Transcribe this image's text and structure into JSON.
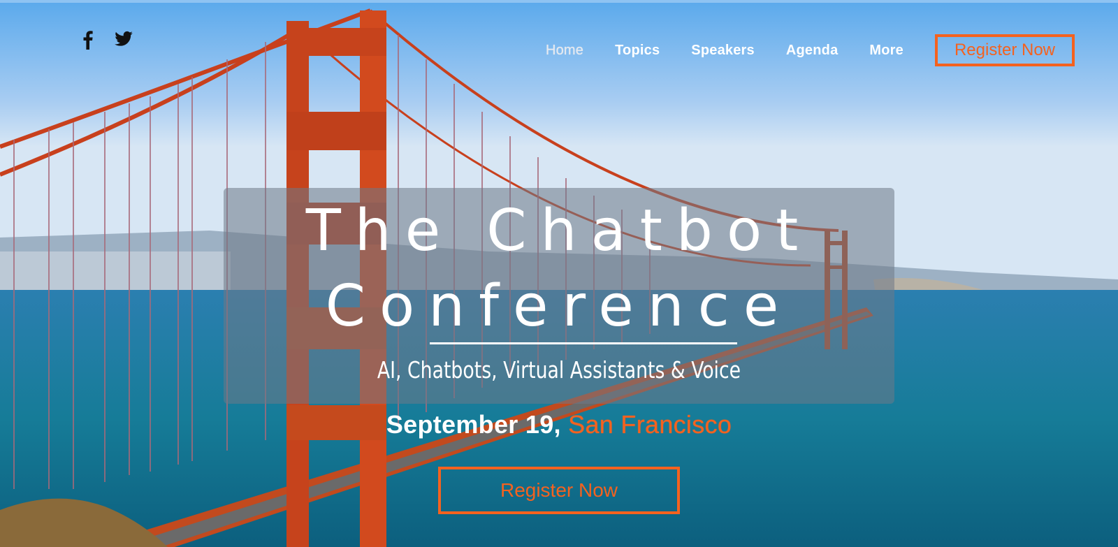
{
  "colors": {
    "accent": "#f4621f",
    "nav_text": "#ffffff",
    "overlay": "rgba(110,120,135,0.55)"
  },
  "social": [
    {
      "name": "facebook",
      "icon": "facebook-icon"
    },
    {
      "name": "twitter",
      "icon": "twitter-icon"
    }
  ],
  "nav": {
    "items": [
      {
        "label": "Home",
        "active": true
      },
      {
        "label": "Topics",
        "active": false
      },
      {
        "label": "Speakers",
        "active": false
      },
      {
        "label": "Agenda",
        "active": false
      },
      {
        "label": "More",
        "active": false
      }
    ],
    "register_label": "Register Now"
  },
  "hero": {
    "title_line1": "The Chatbot",
    "title_line2": "Conference",
    "subtitle": "AI, Chatbots, Virtual Assistants & Voice",
    "date": "September 19,",
    "city": "San Francisco",
    "cta_label": "Register Now"
  },
  "background": {
    "scene": "Golden Gate Bridge over San Francisco Bay"
  }
}
